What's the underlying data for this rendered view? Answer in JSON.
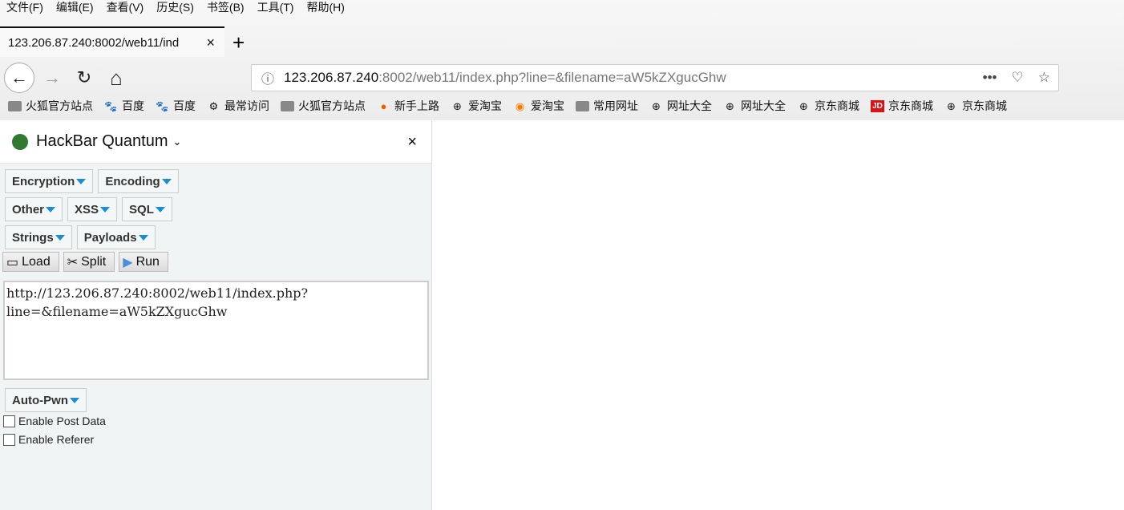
{
  "menu": [
    "文件(F)",
    "编辑(E)",
    "查看(V)",
    "历史(S)",
    "书签(B)",
    "工具(T)",
    "帮助(H)"
  ],
  "tab": {
    "title": "123.206.87.240:8002/web11/ind",
    "close": "×",
    "new": "+"
  },
  "nav": {
    "back": "←",
    "forward": "→",
    "reload": "↻",
    "home": "⌂"
  },
  "url": {
    "host": "123.206.87.240",
    "rest": ":8002/web11/index.php?line=&filename=aW5kZXgucGhw",
    "more": "•••",
    "pocket": "♡",
    "star": "☆",
    "info": "ⓘ"
  },
  "bookmarks": [
    {
      "label": "火狐官方站点",
      "icon": "folder-icon"
    },
    {
      "label": "百度",
      "icon": "baidu-icon"
    },
    {
      "label": "百度",
      "icon": "baidu-icon"
    },
    {
      "label": "最常访问",
      "icon": "gear-icon"
    },
    {
      "label": "火狐官方站点",
      "icon": "folder-icon"
    },
    {
      "label": "新手上路",
      "icon": "firefox-icon"
    },
    {
      "label": "爱淘宝",
      "icon": "globe-icon"
    },
    {
      "label": "爱淘宝",
      "icon": "taobao-icon"
    },
    {
      "label": "常用网址",
      "icon": "folder-icon"
    },
    {
      "label": "网址大全",
      "icon": "globe-icon"
    },
    {
      "label": "网址大全",
      "icon": "globe-icon"
    },
    {
      "label": "京东商城",
      "icon": "globe-icon"
    },
    {
      "label": "京东商城",
      "icon": "jd-icon"
    },
    {
      "label": "京东商城",
      "icon": "globe-icon"
    }
  ],
  "hackbar": {
    "title": "HackBar Quantum",
    "close": "×",
    "row1": [
      "Encryption",
      "Encoding"
    ],
    "row2": [
      "Other",
      "XSS",
      "SQL"
    ],
    "row3": [
      "Strings",
      "Payloads"
    ],
    "load": "Load",
    "split": "Split",
    "run": "Run",
    "text": "http://123.206.87.240:8002/web11/index.php?line=&filename=aW5kZXgucGhw",
    "autopwn": "Auto-Pwn",
    "post": "Enable Post Data",
    "referer": "Enable Referer"
  },
  "accent": "#1a8ed1"
}
